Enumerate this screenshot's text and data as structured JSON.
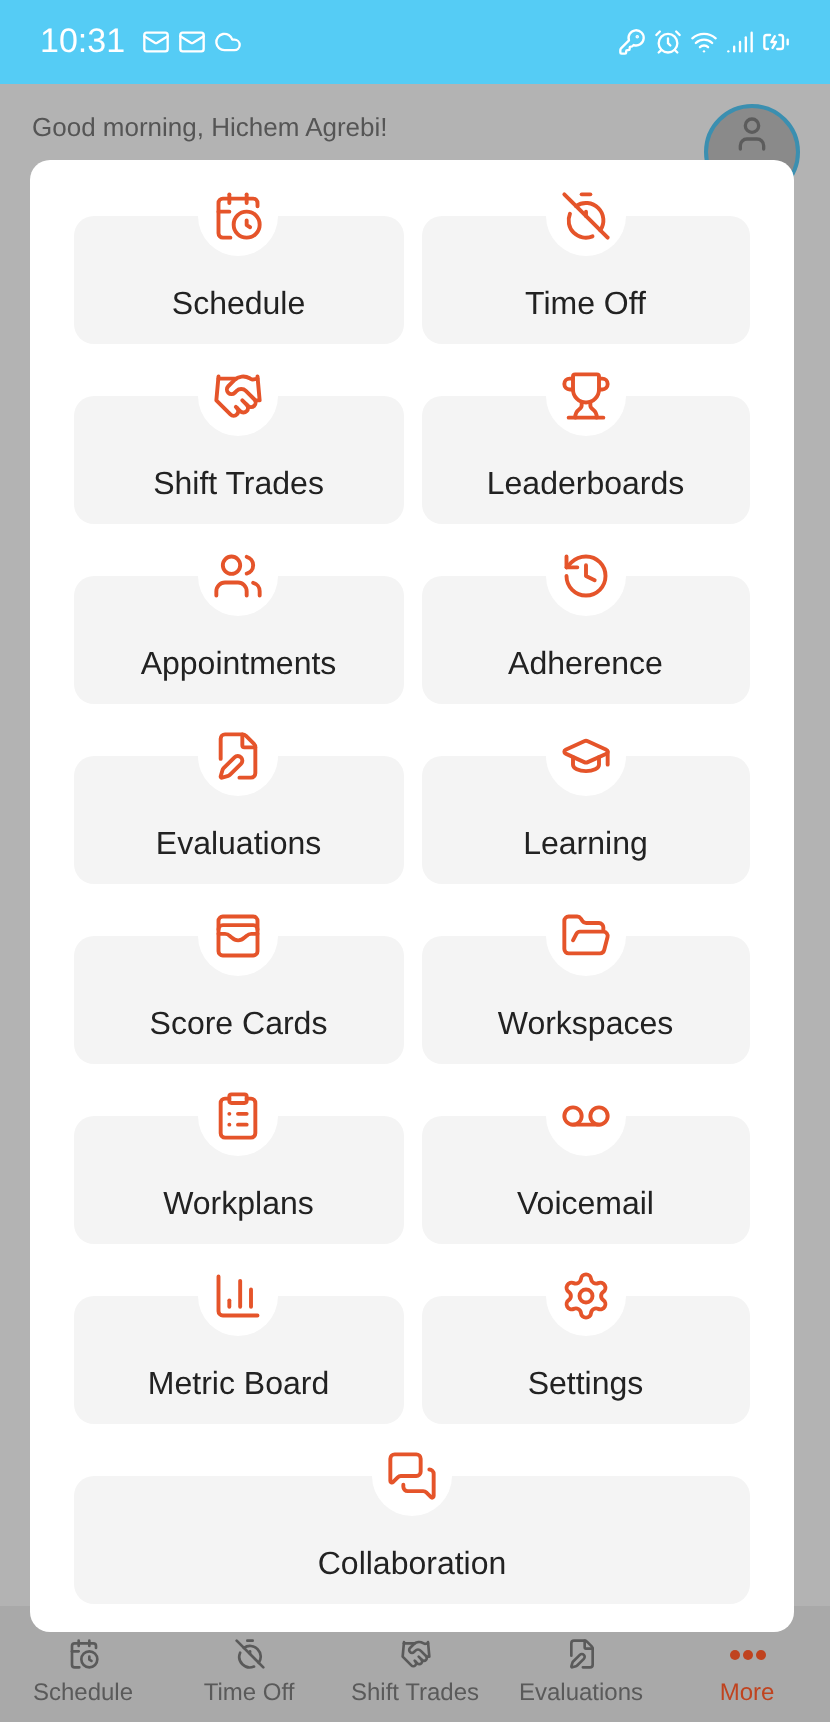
{
  "status_bar": {
    "time": "10:31"
  },
  "greeting": "Good morning, Hichem Agrebi!",
  "menu": {
    "items": [
      {
        "label": "Schedule",
        "wide": false
      },
      {
        "label": "Time Off",
        "wide": false
      },
      {
        "label": "Shift Trades",
        "wide": false
      },
      {
        "label": "Leaderboards",
        "wide": false
      },
      {
        "label": "Appointments",
        "wide": false
      },
      {
        "label": "Adherence",
        "wide": false
      },
      {
        "label": "Evaluations",
        "wide": false
      },
      {
        "label": "Learning",
        "wide": false
      },
      {
        "label": "Score Cards",
        "wide": false
      },
      {
        "label": "Workspaces",
        "wide": false
      },
      {
        "label": "Workplans",
        "wide": false
      },
      {
        "label": "Voicemail",
        "wide": false
      },
      {
        "label": "Metric Board",
        "wide": false
      },
      {
        "label": "Settings",
        "wide": false
      },
      {
        "label": "Collaboration",
        "wide": true
      }
    ]
  },
  "bottom_nav": [
    {
      "label": "Schedule",
      "selected": false
    },
    {
      "label": "Time Off",
      "selected": false
    },
    {
      "label": "Shift Trades",
      "selected": false
    },
    {
      "label": "Evaluations",
      "selected": false
    },
    {
      "label": "More",
      "selected": true
    }
  ]
}
